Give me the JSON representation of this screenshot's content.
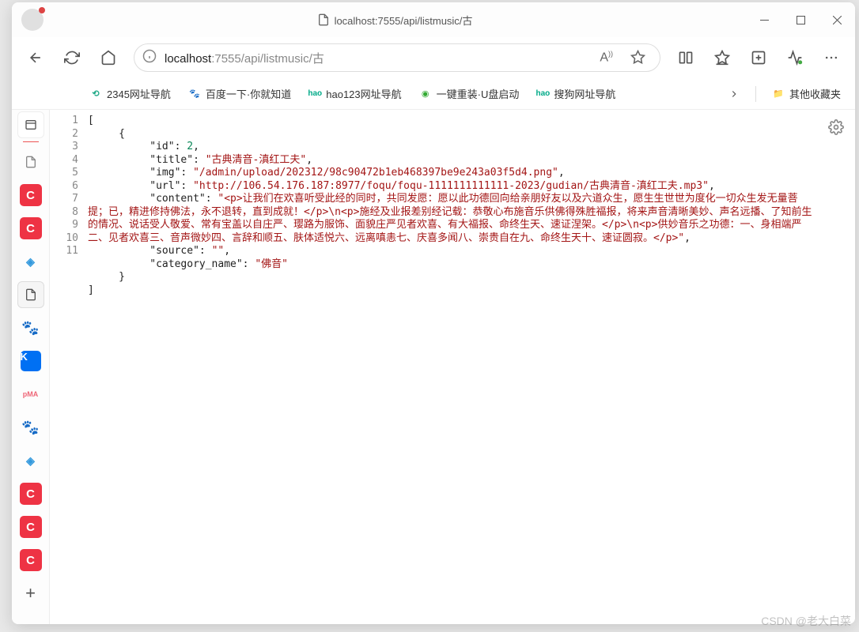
{
  "window": {
    "title": "localhost:7555/api/listmusic/古"
  },
  "url": {
    "prefix": "localhost",
    "path": ":7555/api/listmusic/古"
  },
  "bookmarks": {
    "b1": "2345网址导航",
    "b2": "百度一下·你就知道",
    "b3": "hao123网址导航",
    "b4": "一键重装·U盘启动",
    "b5": "搜狗网址导航",
    "other": "其他收藏夹"
  },
  "line_nums": [
    "1",
    "2",
    "3",
    "4",
    "5",
    "6",
    "7",
    " ",
    " ",
    " ",
    "8",
    "9",
    "10",
    "11"
  ],
  "json_lines": {
    "l1": "[",
    "l2": "     {",
    "l3_pre": "          \"id\": ",
    "l3_val": "2",
    "l3_post": ",",
    "l4_pre": "          \"title\": ",
    "l4_val": "\"古典清音-滇红工夫\"",
    "l4_post": ",",
    "l5_pre": "          \"img\": ",
    "l5_val": "\"/admin/upload/202312/98c90472b1eb468397be9e243a03f5d4.png\"",
    "l5_post": ",",
    "l6_pre": "          \"url\": ",
    "l6_val": "\"http://106.54.176.187:8977/foqu/foqu-1111111111111-2023/gudian/古典清音-滇红工夫.mp3\"",
    "l6_post": ",",
    "l7_pre": "          \"content\": ",
    "l7_val": "\"<p>让我们在欢喜听受此经的同时，共同发愿：愿以此功德回向给亲朋好友以及六道众生，愿生生世世为度化一切众生发无量菩提；已，精进修持佛法，永不退转，直到成就！</p>\\n<p>施经及业报差别经记载：恭敬心布施音乐供佛得殊胜福报，将来声音清晰美妙、声名远播、了知前生的情况、说话受人敬爱、常有宝盖以自庄严、璎路为服饰、面貌庄严见者欢喜、有大福报、命终生天、速证涅架。</p>\\n<p>供妙音乐之功德：一、身相端严二、见者欢喜三、音声微妙四、言辞和顺五、肤体适悦六、远离嗔恚七、庆喜多闻八、崇贵自在九、命终生天十、速证圆寂。</p>\"",
    "l7_post": ",",
    "l8_pre": "          \"source\": ",
    "l8_val": "\"\"",
    "l8_post": ",",
    "l9_pre": "          \"category_name\": ",
    "l9_val": "\"佛音\"",
    "l10": "     }",
    "l11": "]"
  },
  "watermark": "CSDN @老大白菜"
}
